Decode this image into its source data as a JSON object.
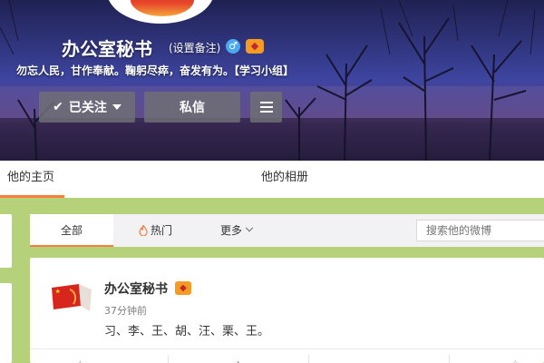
{
  "profile": {
    "name": "办公室秘书",
    "remark_link": "(设置备注)",
    "gender_icon": "male-icon",
    "vip_badge_icon": "vip-badge-icon",
    "bio": "勿忘人民，甘作奉献。鞠躬尽瘁，奋发有为。【学习小组】"
  },
  "actions": {
    "follow_label": "已关注",
    "message_label": "私信",
    "menu_icon": "menu-icon"
  },
  "profile_tabs": [
    {
      "label": "他的主页",
      "active": true
    },
    {
      "label": "他的相册",
      "active": false
    }
  ],
  "feed_tabs": {
    "all": "全部",
    "hot": "热门",
    "more": "更多"
  },
  "search": {
    "placeholder": "搜索他的微博"
  },
  "post": {
    "author": "办公室秘书",
    "time": "37分钟前",
    "text": "习、李、王、胡、汪、栗、王。"
  },
  "colors": {
    "accent": "#fa7d3c",
    "page_bg": "#b5d27a",
    "vip": "#f59a22",
    "gender": "#4aa9f2"
  }
}
